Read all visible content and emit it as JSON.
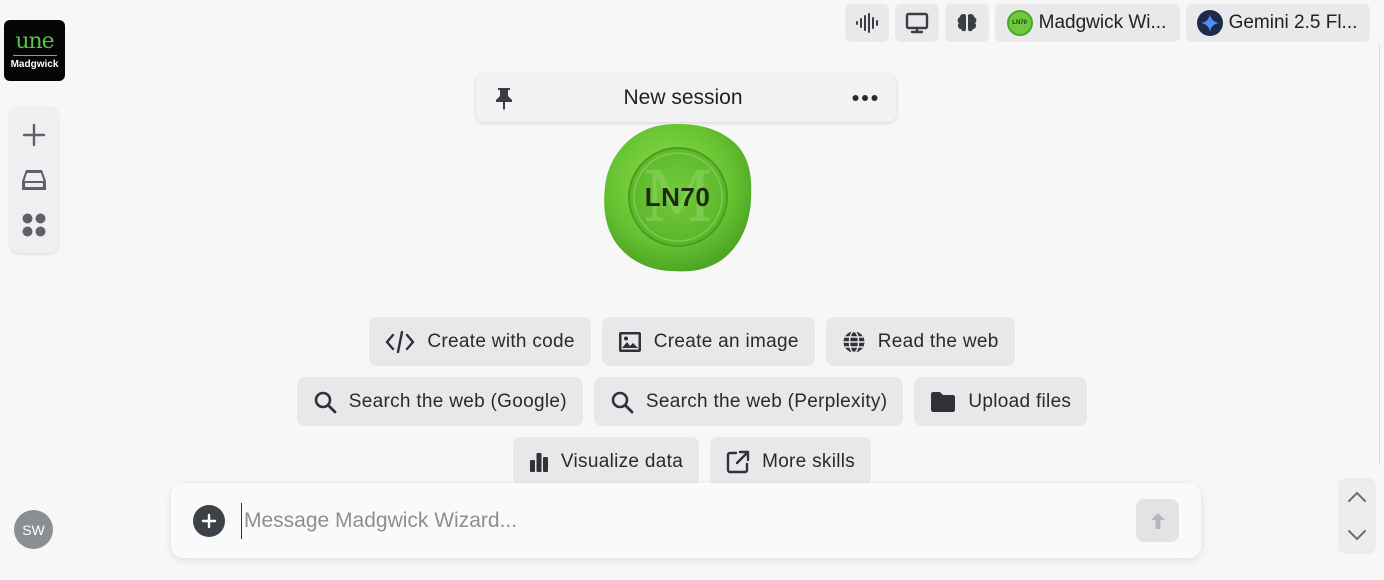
{
  "logo": {
    "mark": "une",
    "name": "Madgwick"
  },
  "rail": {
    "items": [
      {
        "icon": "plus-icon",
        "label": "New"
      },
      {
        "icon": "inbox-icon",
        "label": "Inbox"
      },
      {
        "icon": "apps-grid-icon",
        "label": "Apps"
      }
    ]
  },
  "toolbar": {
    "voice_icon": "audio-waveform-icon",
    "screen_icon": "monitor-icon",
    "brain_icon": "brain-icon",
    "assistant": {
      "label": "Madgwick Wi...",
      "badge": "LN70"
    },
    "model": {
      "label": "Gemini 2.5 Fl..."
    }
  },
  "session": {
    "title": "New session",
    "pin_icon": "pin-icon",
    "more_icon": "more-horizontal-icon"
  },
  "seal": {
    "text": "LN70",
    "watermark": "M"
  },
  "skills": [
    [
      {
        "label": "Create with code",
        "icon": "code-icon"
      },
      {
        "label": "Create an image",
        "icon": "image-icon"
      },
      {
        "label": "Read the web",
        "icon": "globe-icon"
      }
    ],
    [
      {
        "label": "Search the web (Google)",
        "icon": "search-icon"
      },
      {
        "label": "Search the web (Perplexity)",
        "icon": "search-icon"
      },
      {
        "label": "Upload files",
        "icon": "folder-icon"
      }
    ],
    [
      {
        "label": "Visualize data",
        "icon": "bar-chart-icon"
      },
      {
        "label": "More skills",
        "icon": "external-link-icon"
      }
    ]
  ],
  "composer": {
    "placeholder": "Message Madgwick Wizard...",
    "value": ""
  },
  "user": {
    "initials": "SW"
  },
  "colors": {
    "seal_green": "#6fc93c",
    "background": "#f7f7f8",
    "chip": "#e8e8eb"
  }
}
